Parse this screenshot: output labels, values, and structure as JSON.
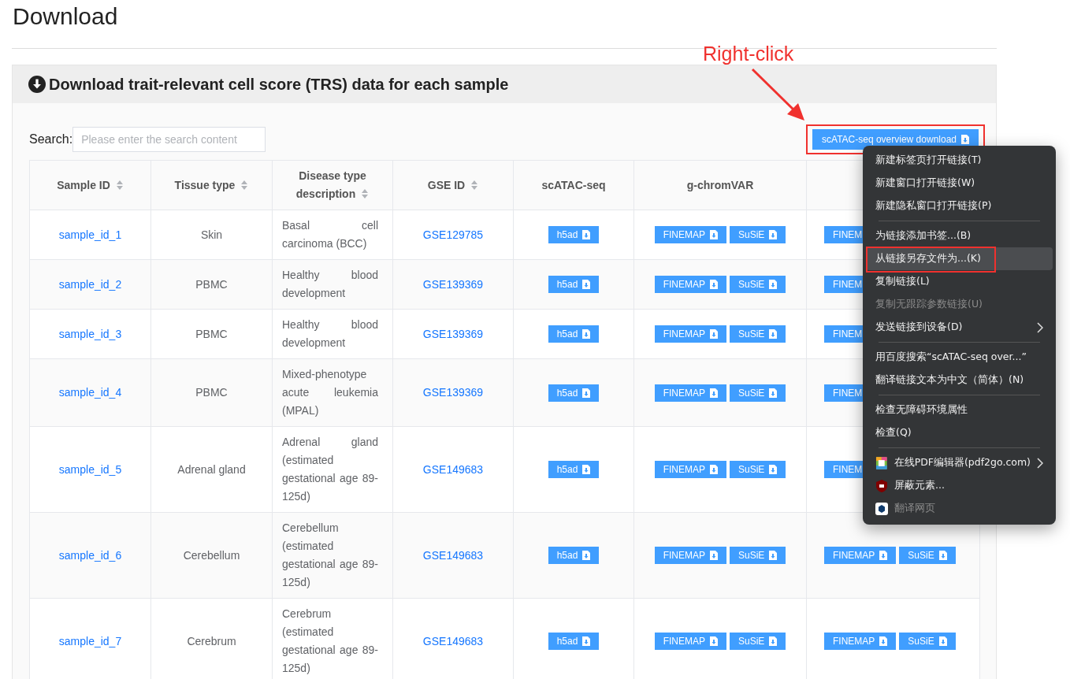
{
  "page_title": "Download",
  "panel": {
    "title": "Download trait-relevant cell score (TRS) data for each sample",
    "search": {
      "label": "Search:",
      "placeholder": "Please enter the search content"
    },
    "overview_button": {
      "label": "scATAC-seq overview download",
      "outlined": true
    },
    "annotation": {
      "label": "Right-click"
    },
    "table": {
      "columns": [
        {
          "label": "Sample ID",
          "sortable": true
        },
        {
          "label": "Tissue type",
          "sortable": true
        },
        {
          "label": "Disease type description",
          "sortable": true
        },
        {
          "label": "GSE ID",
          "sortable": true
        },
        {
          "label": "scATAC-seq",
          "sortable": false
        },
        {
          "label": "g-chromVAR",
          "sortable": false
        }
      ],
      "rows": [
        {
          "sample_id": "sample_id_1",
          "tissue": "Skin",
          "description": "Basal cell carcinoma (BCC)",
          "gse": "GSE129785",
          "scatac": [
            "h5ad"
          ],
          "gchromvar": [
            "FINEMAP",
            "SuSiE"
          ],
          "column_7": [
            {
              "label": "FINEM",
              "cut": true
            }
          ]
        },
        {
          "sample_id": "sample_id_2",
          "tissue": "PBMC",
          "description": "Healthy blood development",
          "gse": "GSE139369",
          "scatac": [
            "h5ad"
          ],
          "gchromvar": [
            "FINEMAP",
            "SuSiE"
          ],
          "column_7": [
            {
              "label": "FINEM",
              "cut": true
            }
          ]
        },
        {
          "sample_id": "sample_id_3",
          "tissue": "PBMC",
          "description": "Healthy blood development",
          "gse": "GSE139369",
          "scatac": [
            "h5ad"
          ],
          "gchromvar": [
            "FINEMAP",
            "SuSiE"
          ],
          "column_7": [
            {
              "label": "FINEM",
              "cut": true
            }
          ]
        },
        {
          "sample_id": "sample_id_4",
          "tissue": "PBMC",
          "description": "Mixed-phenotype acute leukemia (MPAL)",
          "gse": "GSE139369",
          "scatac": [
            "h5ad"
          ],
          "gchromvar": [
            "FINEMAP",
            "SuSiE"
          ],
          "column_7": [
            {
              "label": "FINEM",
              "cut": true
            }
          ]
        },
        {
          "sample_id": "sample_id_5",
          "tissue": "Adrenal gland",
          "description": "Adrenal gland (estimated gestational age 89-125d)",
          "gse": "GSE149683",
          "scatac": [
            "h5ad"
          ],
          "gchromvar": [
            "FINEMAP",
            "SuSiE"
          ],
          "column_7": [
            {
              "label": "FINEM",
              "cut": true
            }
          ]
        },
        {
          "sample_id": "sample_id_6",
          "tissue": "Cerebellum",
          "description": "Cerebellum (estimated gestational age 89-125d)",
          "gse": "GSE149683",
          "scatac": [
            "h5ad"
          ],
          "gchromvar": [
            "FINEMAP",
            "SuSiE"
          ],
          "column_7": [
            {
              "label": "FINEMAP",
              "cut": false
            },
            {
              "label": "SuSiE",
              "cut": false
            }
          ]
        },
        {
          "sample_id": "sample_id_7",
          "tissue": "Cerebrum",
          "description": "Cerebrum (estimated gestational age 89-125d)",
          "gse": "GSE149683",
          "scatac": [
            "h5ad"
          ],
          "gchromvar": [
            "FINEMAP",
            "SuSiE"
          ],
          "column_7": [
            {
              "label": "FINEMAP",
              "cut": false
            },
            {
              "label": "SuSiE",
              "cut": false
            }
          ]
        }
      ]
    }
  },
  "context_menu": {
    "groups": [
      [
        {
          "label": "新建标签页打开链接(T)",
          "kind": "text",
          "selected": false,
          "disabled": false,
          "submenu": false,
          "outlined": false
        },
        {
          "label": "新建窗口打开链接(W)",
          "kind": "text",
          "selected": false,
          "disabled": false,
          "submenu": false,
          "outlined": false
        },
        {
          "label": "新建隐私窗口打开链接(P)",
          "kind": "text",
          "selected": false,
          "disabled": false,
          "submenu": false,
          "outlined": false
        }
      ],
      [
        {
          "label": "为链接添加书签...(B)",
          "kind": "text",
          "selected": false,
          "disabled": false,
          "submenu": false,
          "outlined": false
        },
        {
          "label": "从链接另存文件为...(K)",
          "kind": "text",
          "selected": true,
          "disabled": false,
          "submenu": false,
          "outlined": true
        },
        {
          "label": "复制链接(L)",
          "kind": "text",
          "selected": false,
          "disabled": false,
          "submenu": false,
          "outlined": false
        },
        {
          "label": "复制无跟踪参数链接(U)",
          "kind": "text",
          "selected": false,
          "disabled": true,
          "submenu": false,
          "outlined": false
        },
        {
          "label": "发送链接到设备(D)",
          "kind": "text",
          "selected": false,
          "disabled": false,
          "submenu": true,
          "outlined": false
        }
      ],
      [
        {
          "label": "用百度搜索“scATAC-seq over...”",
          "kind": "text",
          "selected": false,
          "disabled": false,
          "submenu": false,
          "outlined": false
        },
        {
          "label": "翻译链接文本为中文（简体）(N)",
          "kind": "text",
          "selected": false,
          "disabled": false,
          "submenu": false,
          "outlined": false
        }
      ],
      [
        {
          "label": "检查无障碍环境属性",
          "kind": "text",
          "selected": false,
          "disabled": false,
          "submenu": false,
          "outlined": false
        },
        {
          "label": "检查(Q)",
          "kind": "text",
          "selected": false,
          "disabled": false,
          "submenu": false,
          "outlined": false
        }
      ],
      [
        {
          "label": "在线PDF编辑器(pdf2go.com)",
          "kind": "pdf",
          "selected": false,
          "disabled": false,
          "submenu": true,
          "outlined": false
        },
        {
          "label": "屏蔽元素...",
          "kind": "shield",
          "selected": false,
          "disabled": false,
          "submenu": false,
          "outlined": false
        },
        {
          "label": "翻译网页",
          "kind": "translate",
          "selected": false,
          "disabled": true,
          "submenu": false,
          "outlined": false
        }
      ]
    ]
  }
}
